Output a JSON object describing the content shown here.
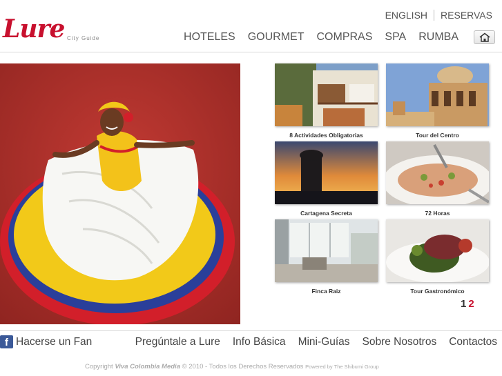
{
  "brand": {
    "logo_text": "Lure",
    "logo_sub": "City Guide"
  },
  "lang_bar": {
    "english": "ENGLISH",
    "reservas": "RESERVAS"
  },
  "nav": {
    "items": [
      "HOTELES",
      "GOURMET",
      "COMPRAS",
      "SPA",
      "RUMBA"
    ],
    "home_icon": "home-icon"
  },
  "hero": {
    "image": "cumbia-dancer-photo"
  },
  "thumbnails": [
    {
      "caption": "8 Actividades Obligatorias",
      "image": "balconies-photo"
    },
    {
      "caption": "Tour del Centro",
      "image": "cathedral-photo"
    },
    {
      "caption": "Cartagena Secreta",
      "image": "sunset-tower-photo"
    },
    {
      "caption": "72 Horas",
      "image": "ceviche-photo"
    },
    {
      "caption": "Finca Raiz",
      "image": "interior-photo"
    },
    {
      "caption": "Tour Gastronómico",
      "image": "gourmet-dish-photo"
    }
  ],
  "pager": {
    "page1": "1",
    "page2": "2",
    "active": "2"
  },
  "footer": {
    "fan_label": "Hacerse un Fan",
    "fb_glyph": "f",
    "links": [
      "Pregúntale a Lure",
      "Info Básica",
      "Mini-Guías",
      "Sobre Nosotros",
      "Contactos"
    ]
  },
  "copyright": {
    "prefix": "Copyright",
    "org": "Viva Colombia Media",
    "middle": "© 2010 - Todos los Derechos Reservados",
    "powered": "Powered by The Shibumi Group"
  },
  "colors": {
    "brand_red": "#c8102e",
    "facebook_blue": "#3b5998",
    "rule": "#d8d8d8"
  }
}
